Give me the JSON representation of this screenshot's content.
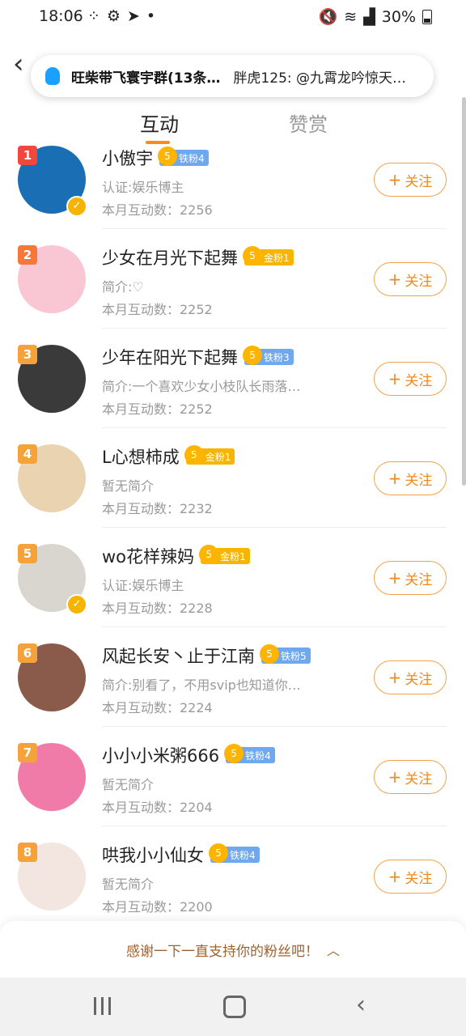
{
  "status_bar": {
    "time": "18:06",
    "battery": "30%"
  },
  "notification": {
    "group_name": "旺柴带飞寰宇群(13条…",
    "message": "胖虎125: @九霄龙吟惊天…"
  },
  "tabs": [
    {
      "label": "互动",
      "active": true
    },
    {
      "label": "赞赏",
      "active": false
    }
  ],
  "fans": [
    {
      "rank": "1",
      "name": "小傲宇",
      "badge": "铁粉4",
      "badge_level": "5",
      "badge_type": "iron",
      "desc": "认证:娱乐博主",
      "count": "本月互动数：2256",
      "verified": true,
      "avatar_color": "#1a6fb4"
    },
    {
      "rank": "2",
      "name": "少女在月光下起舞",
      "badge": "金粉1",
      "badge_level": "5",
      "badge_type": "gold",
      "desc": "简介:♡",
      "count": "本月互动数：2252",
      "verified": false,
      "avatar_color": "#f9c6d4"
    },
    {
      "rank": "3",
      "name": "少年在阳光下起舞",
      "badge": "铁粉3",
      "badge_level": "5",
      "badge_type": "iron",
      "desc": "简介:一个喜欢少女小枝队长雨落…",
      "count": "本月互动数：2252",
      "verified": false,
      "avatar_color": "#3a3a3a"
    },
    {
      "rank": "4",
      "name": "L心想柿成",
      "badge": "金粉1",
      "badge_level": "5",
      "badge_type": "gold",
      "desc": "暂无简介",
      "count": "本月互动数：2232",
      "verified": false,
      "avatar_color": "#e9d3b0"
    },
    {
      "rank": "5",
      "name": "wo花样辣妈",
      "badge": "金粉1",
      "badge_level": "5",
      "badge_type": "gold",
      "desc": "认证:娱乐博主",
      "count": "本月互动数：2228",
      "verified": true,
      "avatar_color": "#d9d6cf"
    },
    {
      "rank": "6",
      "name": "风起长安丶止于江南",
      "badge": "铁粉5",
      "badge_level": "5",
      "badge_type": "iron",
      "desc": "简介:别看了，不用svip也知道你…",
      "count": "本月互动数：2224",
      "verified": false,
      "avatar_color": "#8a5a4a"
    },
    {
      "rank": "7",
      "name": "小小小米粥666",
      "badge": "铁粉4",
      "badge_level": "5",
      "badge_type": "iron",
      "desc": "暂无简介",
      "count": "本月互动数：2204",
      "verified": false,
      "avatar_color": "#f07aa8"
    },
    {
      "rank": "8",
      "name": "哄我小小仙女",
      "badge": "铁粉4",
      "badge_level": "5",
      "badge_type": "iron",
      "desc": "暂无简介",
      "count": "本月互动数：2200",
      "verified": false,
      "avatar_color": "#f3e5e0"
    }
  ],
  "follow_label": "关注",
  "thanks_text": "感谢一下一直支持你的粉丝吧！",
  "colors": {
    "accent": "#ff8a1c",
    "follow_border": "#f4a24a",
    "iron_badge": "#6fa8ef",
    "gold_badge": "#f7b500",
    "rank_1": "#f0483e",
    "rank_2": "#f5773a",
    "rank_other": "#f5a23a"
  },
  "icons": [
    "signal-dots-icon",
    "gear-icon",
    "telegram-icon",
    "mute-icon",
    "wifi-icon",
    "cell-signal-icon",
    "battery-icon",
    "back-arrow-icon",
    "qq-icon",
    "crown-icon",
    "verified-icon",
    "plus-icon",
    "chevron-up-icon"
  ]
}
